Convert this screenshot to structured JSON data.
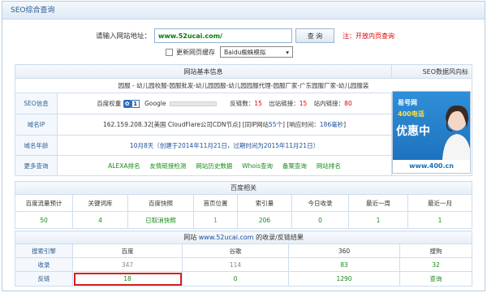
{
  "panel": {
    "title": "SEO综合查询"
  },
  "query": {
    "label": "请输入网站地址：",
    "value": "www.52ucai.com/",
    "button": "查 询",
    "tip": "注：开放内页查询",
    "refresh_label": "更新网页缓存",
    "select_value": "Baidu蜘蛛模拟"
  },
  "basic": {
    "header": "网站基本信息",
    "data_link": "SEO数据风向标",
    "keywords": "园服 - 幼儿园校服-园服批发-幼儿园园服-幼儿园园服代理-园服厂家-广东园服厂家-幼儿园服装",
    "rows": {
      "seo": {
        "label": "SEO信息",
        "baidu_weight_label": "百度权重",
        "baidu_weight_value": "1",
        "google_label": "Google",
        "backlinks_label": "反链数：",
        "backlinks_value": "15",
        "outlinks_label": "出站链接：",
        "outlinks_value": "15",
        "inlinks_label": "站内链接：",
        "inlinks_value": "80"
      },
      "ip": {
        "label": "域名IP",
        "ip_text": "162.159.208.32[美国 CloudFlare公司CDN节点]",
        "same_ip_prefix": "[同IP网站",
        "same_ip_value": "55个",
        "same_ip_suffix": "]",
        "resp_prefix": "[响应时间：",
        "resp_value": "186毫秒",
        "resp_suffix": "]"
      },
      "age": {
        "label": "域名年龄",
        "age_value": "10月8天",
        "age_detail": "（创建于2014年11月21日，过期时间为2015年11月21日）"
      },
      "more": {
        "label": "更多查询",
        "links": [
          "ALEXA排名",
          "友情链接检测",
          "网站历史数据",
          "Whois查询",
          "备案查询",
          "网站排名"
        ]
      }
    }
  },
  "ad": {
    "brand": "易号网",
    "phone": "400电话",
    "promo": "优惠中",
    "url": "www.400.cn"
  },
  "baidu": {
    "header": "百度相关",
    "columns": [
      "百度流量预计",
      "关键词库",
      "百度快照",
      "首页位置",
      "索引量",
      "今日收录",
      "最近一周",
      "最近一月"
    ],
    "values": [
      "50",
      "4",
      "已取消快照",
      "1",
      "206",
      "0",
      "1",
      "1"
    ]
  },
  "index": {
    "header_prefix": "网站",
    "header_site": "www.52ucai.com",
    "header_suffix": "的收录/反链结果",
    "columns": [
      "搜索引擎",
      "百度",
      "谷歌",
      "360",
      "搜狗"
    ],
    "rows": [
      {
        "label": "收录",
        "values": [
          "347",
          "114",
          "83",
          "32"
        ]
      },
      {
        "label": "反链",
        "values": [
          "18",
          "0",
          "1290",
          "查询"
        ]
      }
    ]
  },
  "colors": {
    "accent": "#2b5f93",
    "border": "#cfdded",
    "value_red": "#e00000",
    "value_green": "#1a8a1a",
    "highlight": "#d62020"
  }
}
